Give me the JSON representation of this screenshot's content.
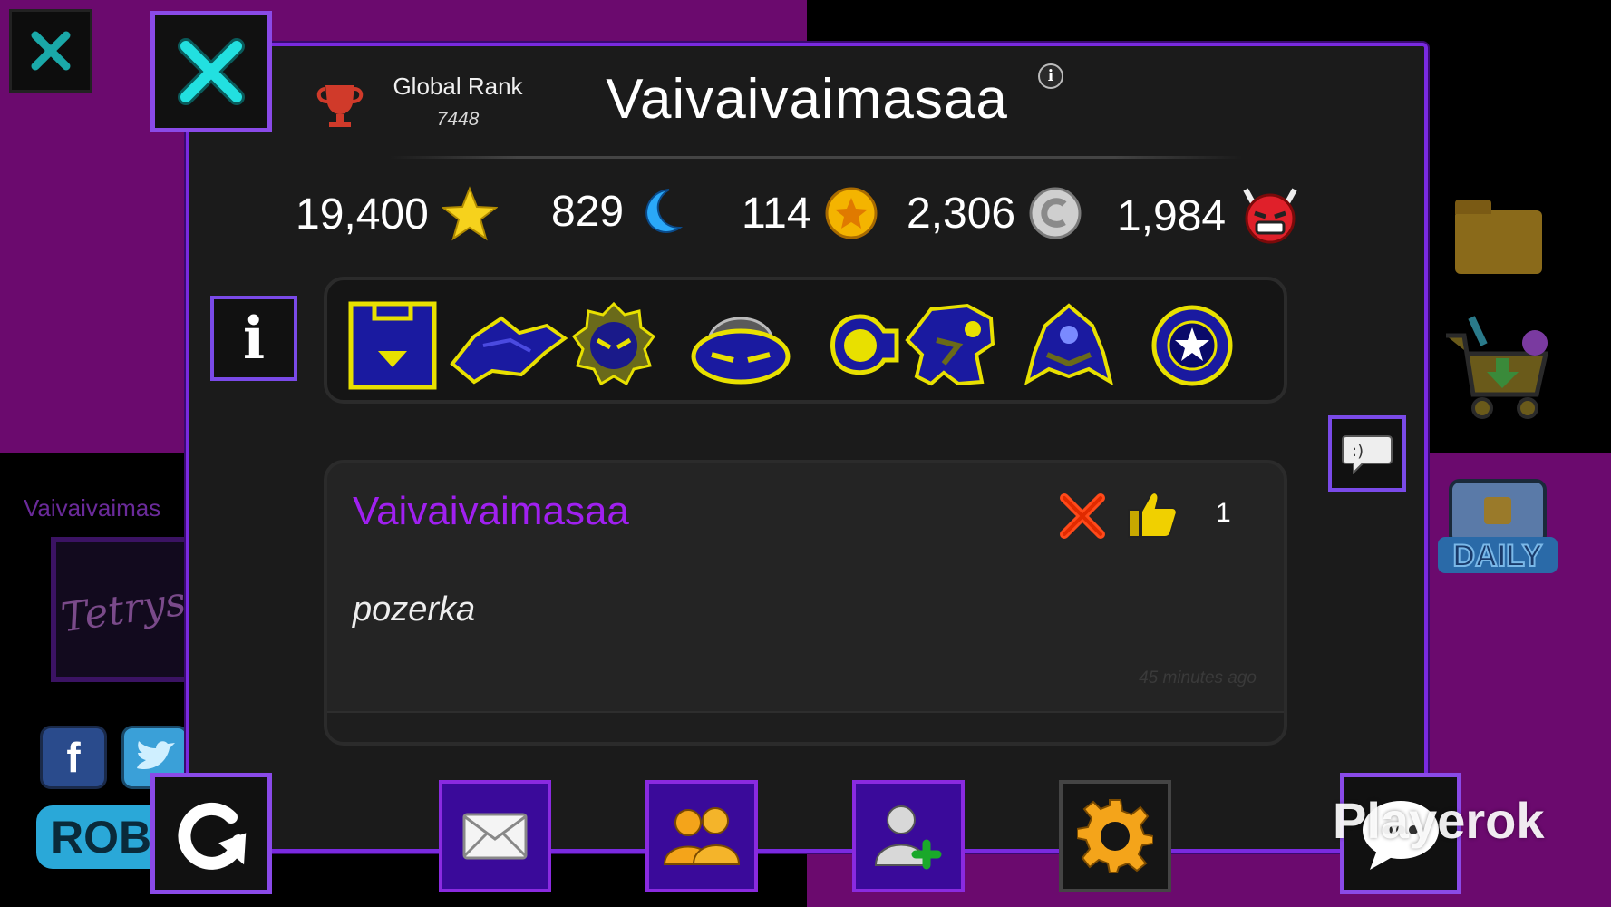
{
  "background": {
    "username": "Vaivaivaimas",
    "logo_text": "Tetrys",
    "facebook_glyph": "f",
    "rob_text": "ROB"
  },
  "profile": {
    "global_rank_label": "Global Rank",
    "global_rank_value": "7448",
    "username": "Vaivaivaimasaa",
    "info_glyph": "i"
  },
  "stats": [
    {
      "value": "19,400",
      "icon": "star-icon",
      "color": "#f6d21c"
    },
    {
      "value": "829",
      "icon": "moon-icon",
      "color": "#2aa8f8"
    },
    {
      "value": "114",
      "icon": "secret-coin-icon",
      "color": "#f4b400"
    },
    {
      "value": "2,306",
      "icon": "user-coin-icon",
      "color": "#cfcfcf"
    },
    {
      "value": "1,984",
      "icon": "demon-icon",
      "color": "#e0202a"
    }
  ],
  "icons_info_glyph": "i",
  "game_icons": [
    "cube-icon",
    "ship-icon",
    "ball-icon",
    "ufo-icon",
    "wave-icon",
    "robot-icon",
    "spider-icon",
    "swing-icon"
  ],
  "comment": {
    "author": "Vaivaivaimasaa",
    "text": "pozerka",
    "time": "45 minutes ago",
    "likes": "1"
  },
  "watermark": "Playerok",
  "colors": {
    "accent_purple": "#8a4ae8",
    "author_purple": "#a020f0",
    "icon_yellow": "#e8e000",
    "icon_blue": "#1a1aa0"
  }
}
